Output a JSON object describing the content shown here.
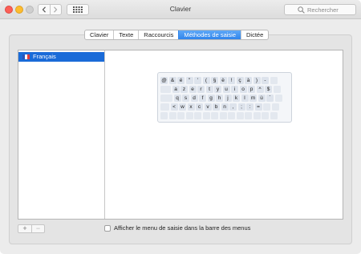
{
  "window": {
    "title": "Clavier"
  },
  "search": {
    "placeholder": "Rechercher"
  },
  "tabs": [
    {
      "label": "Clavier",
      "active": false
    },
    {
      "label": "Texte",
      "active": false
    },
    {
      "label": "Raccourcis",
      "active": false
    },
    {
      "label": "Méthodes de saisie",
      "active": true
    },
    {
      "label": "Dictée",
      "active": false
    }
  ],
  "input_sources": [
    {
      "label": "Français",
      "selected": true
    }
  ],
  "keyboard": {
    "rows": [
      [
        "@",
        "&",
        "é",
        "\"",
        "'",
        "(",
        "§",
        "è",
        "!",
        "ç",
        "à",
        ")",
        "-",
        ""
      ],
      [
        "",
        "a",
        "z",
        "e",
        "r",
        "t",
        "y",
        "u",
        "i",
        "o",
        "p",
        "^",
        "$",
        ""
      ],
      [
        "",
        "q",
        "s",
        "d",
        "f",
        "g",
        "h",
        "j",
        "k",
        "l",
        "m",
        "ù",
        "`",
        ""
      ],
      [
        "",
        "<",
        "w",
        "x",
        "c",
        "v",
        "b",
        "n",
        ",",
        ";",
        ":",
        "=",
        "",
        ""
      ],
      [
        "",
        "",
        "",
        "",
        "",
        "",
        "",
        "",
        "",
        "",
        "",
        "",
        "",
        ""
      ]
    ]
  },
  "bottom": {
    "add_label": "+",
    "remove_label": "−",
    "show_menu_checked": false,
    "show_menu_label": "Afficher le menu de saisie dans la barre des menus"
  },
  "colors": {
    "accent": "#2f84ec",
    "selection": "#1a6bd8",
    "close": "#fc5f57",
    "minimize": "#fdbc2e"
  }
}
